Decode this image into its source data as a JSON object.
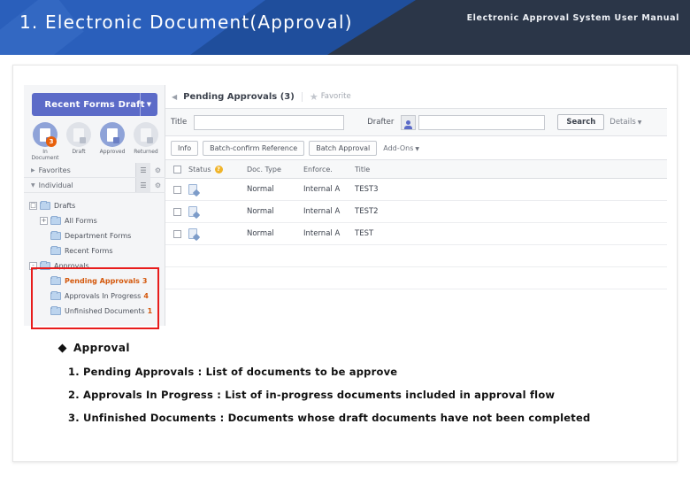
{
  "header": {
    "title": "1. Electronic Document(Approval)",
    "subtitle": "Electronic Approval System User Manual"
  },
  "sidebar": {
    "draft_button": {
      "label": "Recent Forms Draft",
      "caret": "chevron-down-icon"
    },
    "quick_items": [
      {
        "label": "In Document",
        "badge": "3",
        "style": "blue"
      },
      {
        "label": "Draft",
        "badge": "",
        "style": "grey"
      },
      {
        "label": "Approved",
        "badge": "",
        "style": "blue"
      },
      {
        "label": "Returned",
        "badge": "",
        "style": "grey"
      }
    ],
    "top_rows": [
      {
        "label": "Favorites",
        "arrow": "▶"
      },
      {
        "label": "Individual",
        "arrow": "▼"
      }
    ],
    "tree": [
      {
        "label": "Drafts",
        "expander": "□",
        "indent": 0,
        "count": ""
      },
      {
        "label": "All Forms",
        "expander": "+",
        "indent": 1,
        "count": ""
      },
      {
        "label": "Department Forms",
        "expander": "",
        "indent": 1,
        "count": ""
      },
      {
        "label": "Recent Forms",
        "expander": "",
        "indent": 1,
        "count": ""
      },
      {
        "label": "Approvals",
        "expander": "-",
        "indent": 0,
        "count": ""
      },
      {
        "label": "Pending Approvals",
        "expander": "",
        "indent": 1,
        "count": "3"
      },
      {
        "label": "Approvals In Progress",
        "expander": "",
        "indent": 1,
        "count": "4"
      },
      {
        "label": "Unfinished Documents",
        "expander": "",
        "indent": 1,
        "count": "1"
      }
    ]
  },
  "pane": {
    "back_icon": "chevron-left-icon",
    "title": "Pending Approvals (3)",
    "favorite_label": "Favorite",
    "search": {
      "title_label": "Title",
      "title_value": "",
      "drafter_label": "Drafter",
      "drafter_value": "",
      "search_button": "Search",
      "details_label": "Details"
    },
    "toolbar": {
      "info": "Info",
      "batch_reference": "Batch-confirm Reference",
      "batch_approval": "Batch Approval",
      "addons": "Add-Ons"
    },
    "table": {
      "headers": {
        "status": "Status",
        "doc_type": "Doc. Type",
        "enforce": "Enforce.",
        "title": "Title"
      },
      "rows": [
        {
          "doc_type": "Normal",
          "enforce": "Internal A",
          "title": "TEST3"
        },
        {
          "doc_type": "Normal",
          "enforce": "Internal A",
          "title": "TEST2"
        },
        {
          "doc_type": "Normal",
          "enforce": "Internal A",
          "title": "TEST"
        }
      ]
    }
  },
  "description": {
    "heading": "Approval",
    "items": [
      "1. Pending Approvals : List of documents to be approve",
      "2. Approvals In Progress : List of in-progress documents included in approval flow",
      "3. Unfinished Documents : Documents whose draft documents have not been completed"
    ]
  },
  "colors": {
    "header_dark": "#2b3648",
    "header_blue": "#1f4e9c",
    "accent_purple": "#5c6bc8",
    "highlight_red": "#e81c1c",
    "highlight_orange": "#d4580c"
  }
}
